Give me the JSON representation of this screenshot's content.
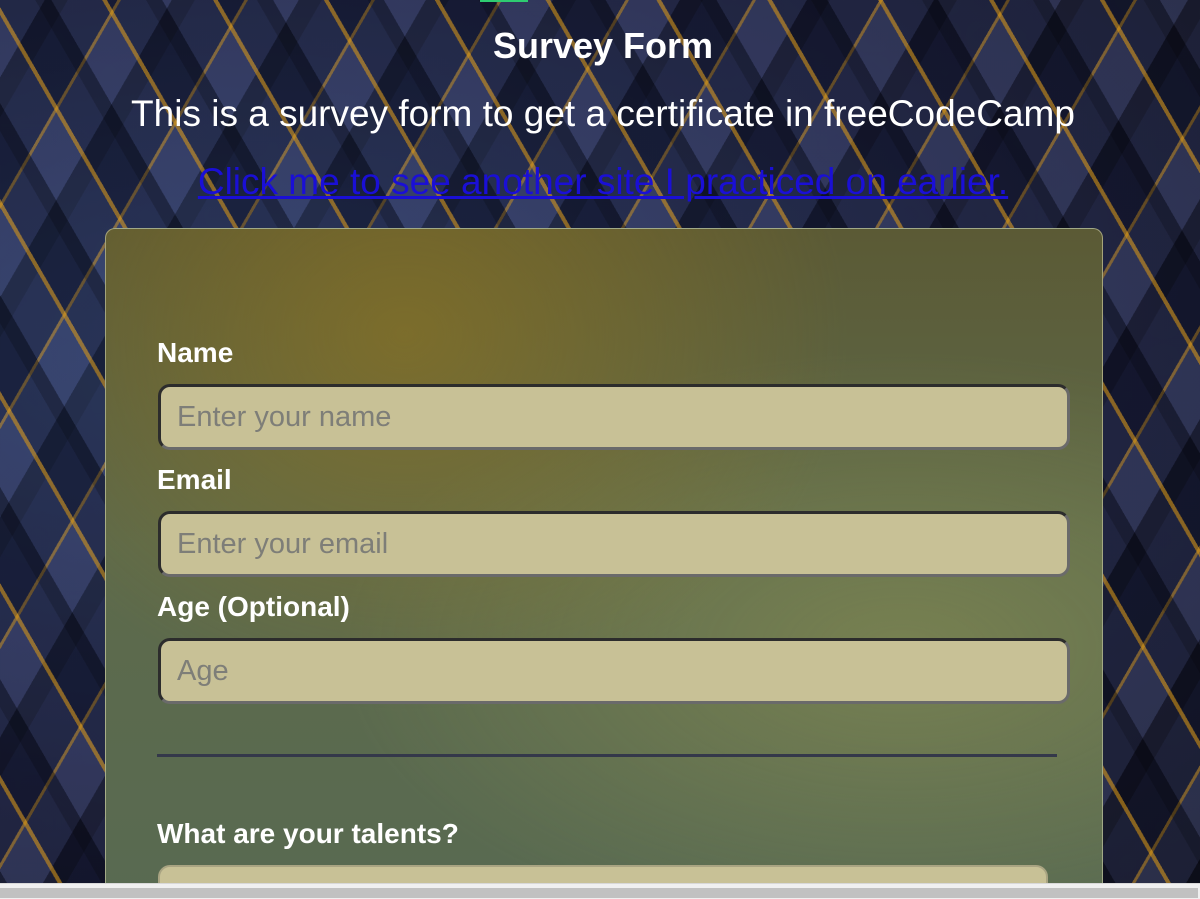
{
  "header": {
    "title": "Survey Form",
    "description": "This is a survey form to get a certificate in freeCodeCamp",
    "link_text": "Click me to see another site I practiced on earlier."
  },
  "form": {
    "fields": [
      {
        "label": "Name",
        "placeholder": "Enter your name"
      },
      {
        "label": "Email",
        "placeholder": "Enter your email"
      },
      {
        "label": "Age (Optional)",
        "placeholder": "Age"
      }
    ],
    "talents_label": "What are your talents?"
  },
  "colors": {
    "link": "#1a0fd6",
    "input_background": "#c8c196",
    "card_background": "#5d6a4b",
    "accent_orange": "#e6a014"
  }
}
